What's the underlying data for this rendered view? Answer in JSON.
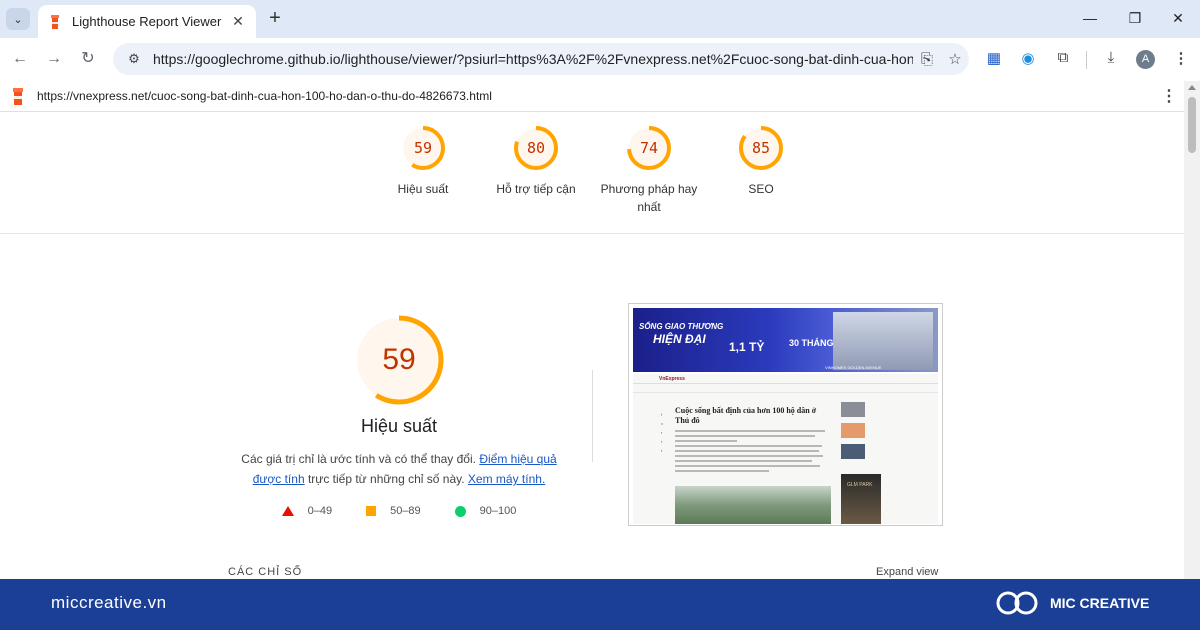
{
  "browser": {
    "tab_title": "Lighthouse Report Viewer",
    "tab_close": "✕",
    "new_tab": "+",
    "address_url": "https://googlechrome.github.io/lighthouse/viewer/?psiurl=https%3A%2F%2Fvnexpress.net%2Fcuoc-song-bat-dinh-cua-hon-10...",
    "profile_initial": "A"
  },
  "report": {
    "page_url": "https://vnexpress.net/cuoc-song-bat-dinh-cua-hon-100-ho-dan-o-thu-do-4826673.html",
    "categories": [
      {
        "score": "59",
        "label": "Hiệu suất",
        "value": 59,
        "color": "#ffa400"
      },
      {
        "score": "80",
        "label": "Hỗ trợ tiếp cận",
        "value": 80,
        "color": "#ffa400"
      },
      {
        "score": "74",
        "label": "Phương pháp hay nhất",
        "value": 74,
        "color": "#ffa400"
      },
      {
        "score": "85",
        "label": "SEO",
        "value": 85,
        "color": "#ffa400"
      }
    ],
    "performance": {
      "score": "59",
      "value": 59,
      "title": "Hiệu suất",
      "desc_prefix": "Các giá trị chỉ là ước tính và có thể thay đổi. ",
      "desc_link1": "Điểm hiệu quả được tính",
      "desc_middle": " trực tiếp từ những chỉ số này. ",
      "desc_link2": "Xem máy tính."
    },
    "legend": [
      {
        "shape": "triangle",
        "label": "0–49",
        "color": "#eb0f00"
      },
      {
        "shape": "square",
        "label": "50–89",
        "color": "#ffa400"
      },
      {
        "shape": "circle",
        "label": "90–100",
        "color": "#0cce6b"
      }
    ],
    "screenshot": {
      "banner_line1": "SỐNG GIAO THƯƠNG",
      "banner_line2": "HIỆN ĐẠI",
      "banner_price": "1,1 TỶ",
      "banner_term": "30 THÁNG",
      "banner_footer": "VINHOMES GOLDEN AVENUE",
      "site_logo": "VnExpress",
      "headline": "Cuộc sống bất định của hơn 100 hộ dân ở Thủ đô",
      "ad_text": "GLM PARK"
    },
    "section_label": "CÁC CHỈ SỐ",
    "expand_label": "Expand view"
  },
  "footer": {
    "site": "miccreative.vn",
    "brand": "MIC CREATIVE"
  },
  "colors": {
    "accent_orange": "#ffa400",
    "score_text": "#c33300",
    "footer_bg": "#1c3f96",
    "link": "#1a57c6"
  }
}
